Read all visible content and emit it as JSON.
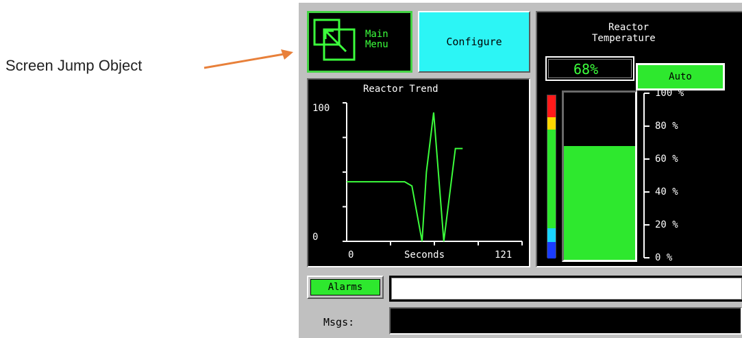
{
  "annotation": {
    "label": "Screen Jump Object",
    "arrow_color": "#e8803a"
  },
  "buttons": {
    "main_menu_line1": "Main",
    "main_menu_line2": "Menu",
    "main_menu_icon": "screen-jump-icon",
    "configure": "Configure",
    "alarms": "Alarms"
  },
  "trend": {
    "title": "Reactor Trend",
    "y_max": "100",
    "y_min": "0",
    "x_min": "0",
    "x_label": "Seconds",
    "x_max": "121"
  },
  "temperature": {
    "title_line1": "Reactor",
    "title_line2": "Temperature",
    "value_display": "68%",
    "value": 68,
    "mode": "Auto",
    "scale": [
      "100 %",
      "80 %",
      "60 %",
      "40 %",
      "20 %",
      "0 %"
    ]
  },
  "messages": {
    "label": "Msgs:",
    "alarm_text": "",
    "msg_text": ""
  },
  "chart_data": {
    "type": "line",
    "title": "Reactor Trend",
    "xlabel": "Seconds",
    "ylabel": "",
    "xlim": [
      0,
      121
    ],
    "ylim": [
      0,
      100
    ],
    "series": [
      {
        "values_x": [
          0,
          10,
          20,
          30,
          40,
          45,
          52,
          55,
          60,
          67,
          75,
          80
        ],
        "values_y": [
          43,
          43,
          43,
          43,
          43,
          40,
          0,
          50,
          93,
          0,
          67,
          67
        ]
      }
    ]
  },
  "colors": {
    "accent_green": "#3cff3c",
    "button_cyan": "#2cf5f5",
    "alarm_red": "#ff1a1a",
    "alarm_yellow": "#ffd700",
    "low_cyan": "#1ad4ff",
    "low_blue": "#1a3cff"
  }
}
